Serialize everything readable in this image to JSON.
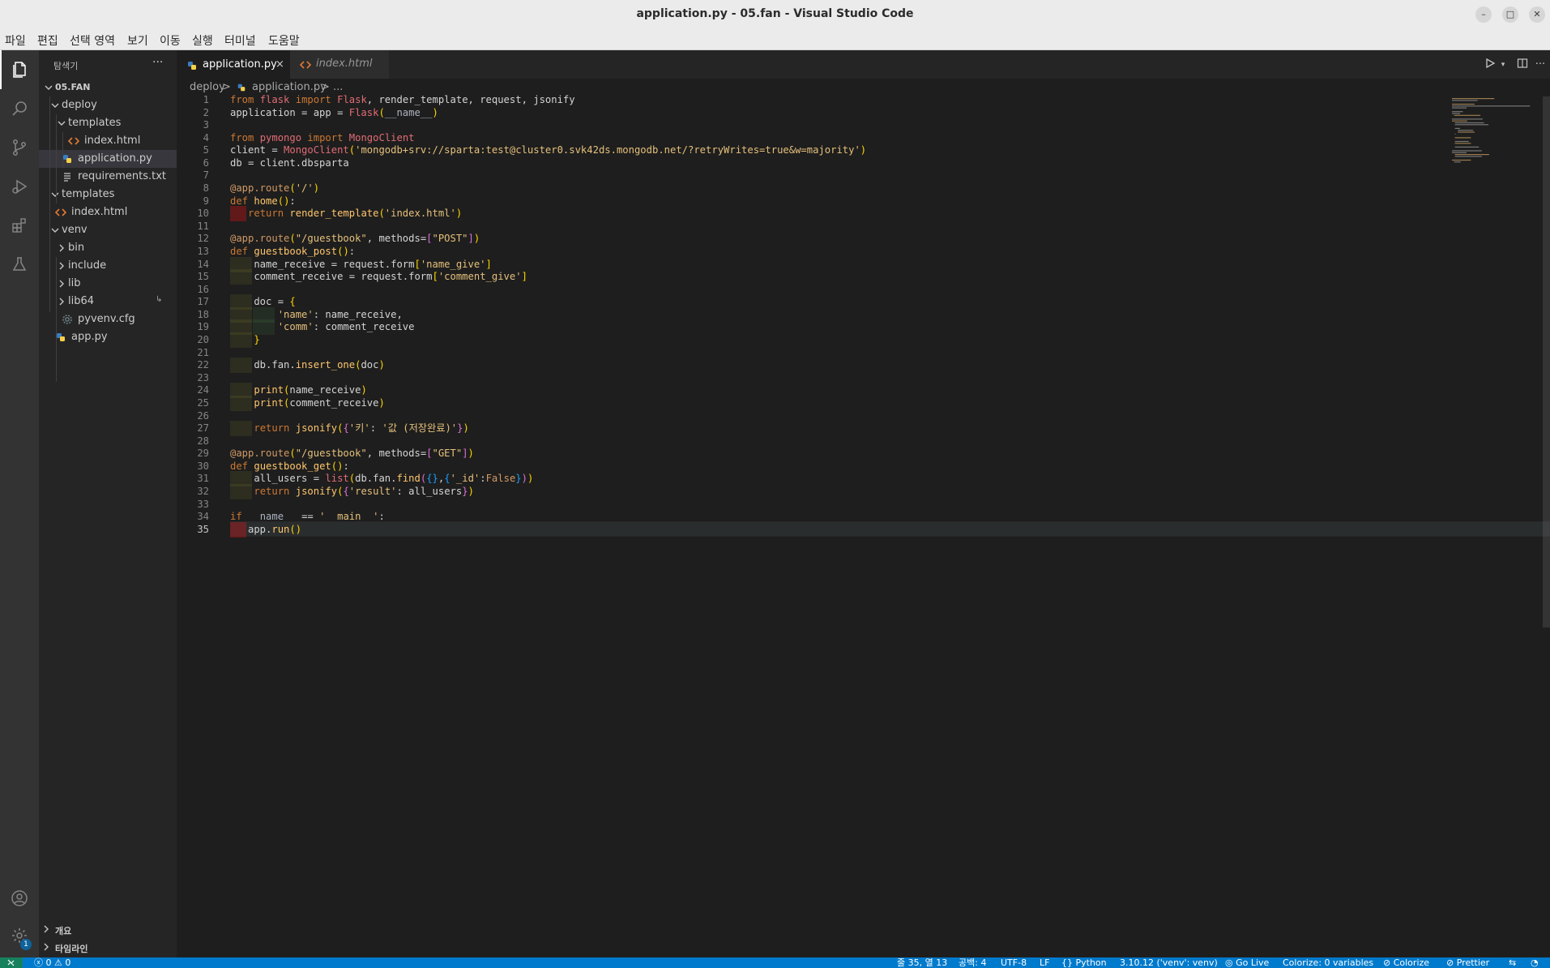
{
  "window": {
    "title": "application.py - 05.fan - Visual Studio Code"
  },
  "menu": {
    "items": [
      "파일",
      "편집",
      "선택 영역",
      "보기",
      "이동",
      "실행",
      "터미널",
      "도움말"
    ]
  },
  "activity_bar": {
    "icons": [
      "files-icon",
      "search-icon",
      "source-control-icon",
      "run-debug-icon",
      "extensions-icon",
      "testing-icon"
    ],
    "bottom_icons": [
      "account-icon",
      "settings-gear-icon"
    ],
    "settings_badge": "1"
  },
  "sidebar": {
    "title": "탐색기",
    "more": "···",
    "tree": [
      {
        "label": "05.FAN",
        "kind": "root"
      },
      {
        "label": "deploy",
        "kind": "folder-open"
      },
      {
        "label": "templates",
        "kind": "folder-open"
      },
      {
        "label": "index.html",
        "kind": "html"
      },
      {
        "label": "application.py",
        "kind": "python"
      },
      {
        "label": "requirements.txt",
        "kind": "text"
      },
      {
        "label": "templates",
        "kind": "folder-open"
      },
      {
        "label": "index.html",
        "kind": "html"
      },
      {
        "label": "venv",
        "kind": "folder-open"
      },
      {
        "label": "bin",
        "kind": "folder-closed"
      },
      {
        "label": "include",
        "kind": "folder-closed"
      },
      {
        "label": "lib",
        "kind": "folder-closed"
      },
      {
        "label": "lib64",
        "kind": "folder-closed"
      },
      {
        "label": "pyvenv.cfg",
        "kind": "config"
      },
      {
        "label": "app.py",
        "kind": "python"
      }
    ],
    "bottom_sections": [
      "개요",
      "타임라인"
    ]
  },
  "tabs": [
    {
      "label": "application.py",
      "active": true,
      "close": "×"
    },
    {
      "label": "index.html",
      "active": false
    }
  ],
  "breadcrumb": {
    "folder": "deploy",
    "sep": ">",
    "file": "application.py",
    "more": "..."
  },
  "editor": {
    "current_line": 35,
    "lines": [
      "from flask import Flask, render_template, request, jsonify",
      "application = app = Flask(__name__)",
      "",
      "from pymongo import MongoClient",
      "client = MongoClient('mongodb+srv://sparta:test@cluster0.svk42ds.mongodb.net/?retryWrites=true&w=majority')",
      "db = client.dbsparta",
      "",
      "@app.route('/')",
      "def home():",
      "   return render_template('index.html')",
      "",
      "@app.route(\"/guestbook\", methods=[\"POST\"])",
      "def guestbook_post():",
      "    name_receive = request.form['name_give']",
      "    comment_receive = request.form['comment_give']",
      "",
      "    doc = {",
      "        'name': name_receive,",
      "        'comm': comment_receive",
      "    }",
      "",
      "    db.fan.insert_one(doc)",
      "",
      "    print(name_receive)",
      "    print(comment_receive)",
      "",
      "    return jsonify({'키': '값 (저장완료)'})",
      "",
      "@app.route(\"/guestbook\", methods=[\"GET\"])",
      "def guestbook_get():",
      "    all_users = list(db.fan.find({},{'_id':False}))",
      "    return jsonify({'result': all_users})",
      "",
      "if __name__ == '__main__':",
      "   app.run()"
    ]
  },
  "statusbar": {
    "errors": "0",
    "warnings": "0",
    "position": "줄 35, 열 13",
    "spaces": "공백: 4",
    "encoding": "UTF-8",
    "eol": "LF",
    "language": "Python",
    "interpreter": "3.10.12 ('venv': venv)",
    "golive": "Go Live",
    "colorize_vars": "Colorize: 0 variables",
    "colorize": "Colorize",
    "prettier": "Prettier"
  },
  "colors": {
    "accent": "#007acc",
    "activity_bar": "#333333",
    "sidebar": "#252526",
    "editor": "#1e1e1e"
  }
}
